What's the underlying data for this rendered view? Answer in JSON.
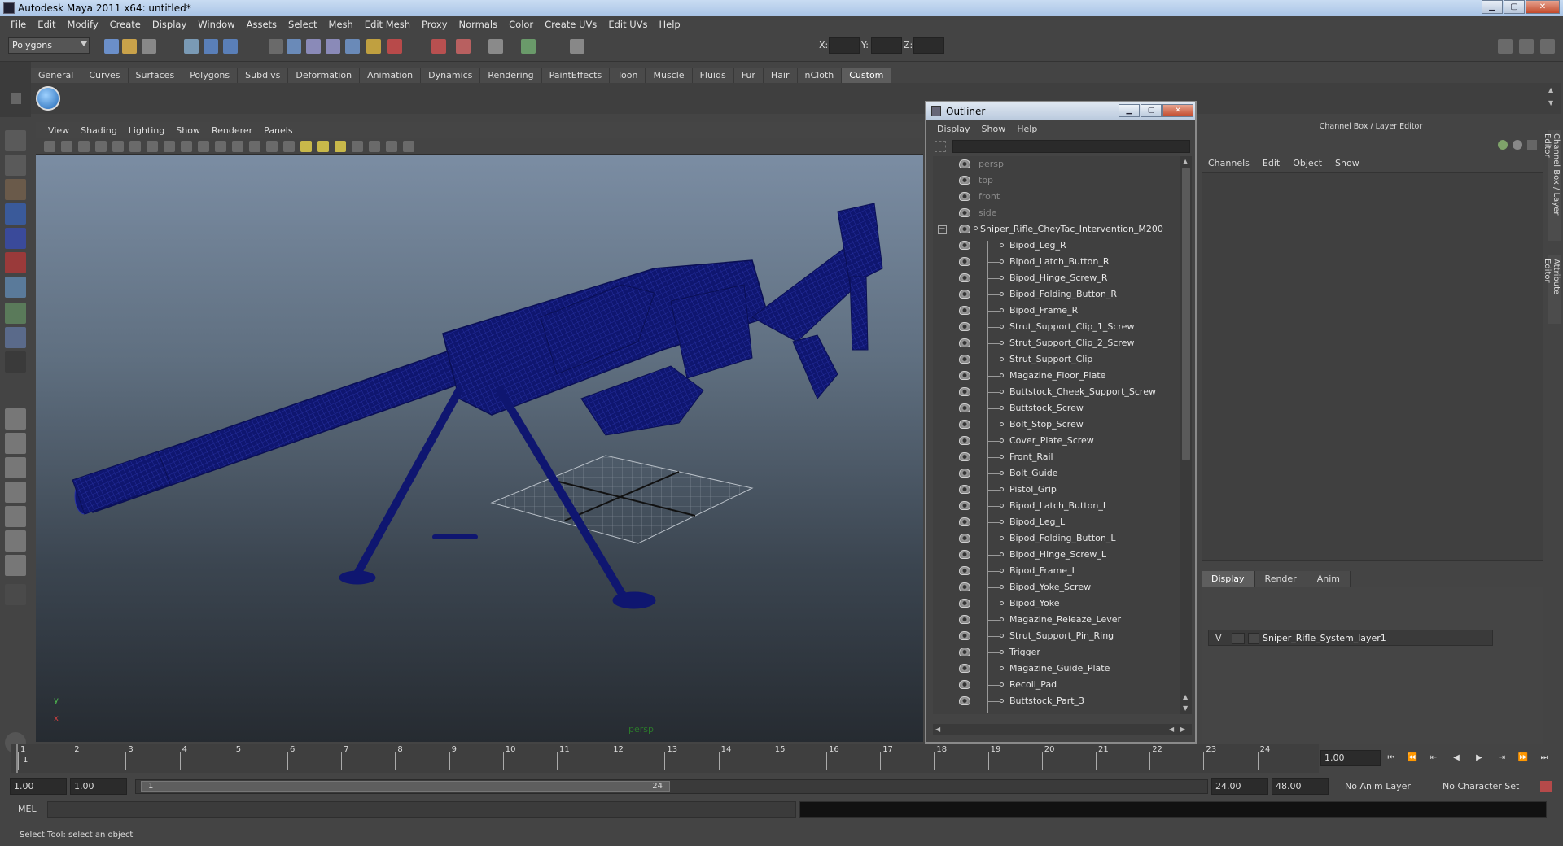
{
  "window": {
    "title": "Autodesk Maya 2011 x64: untitled*"
  },
  "menus": [
    "File",
    "Edit",
    "Modify",
    "Create",
    "Display",
    "Window",
    "Assets",
    "Select",
    "Mesh",
    "Edit Mesh",
    "Proxy",
    "Normals",
    "Color",
    "Create UVs",
    "Edit UVs",
    "Help"
  ],
  "toolbar": {
    "mode": "Polygons",
    "x_label": "X:",
    "y_label": "Y:",
    "z_label": "Z:"
  },
  "shelf_tabs": [
    "General",
    "Curves",
    "Surfaces",
    "Polygons",
    "Subdivs",
    "Deformation",
    "Animation",
    "Dynamics",
    "Rendering",
    "PaintEffects",
    "Toon",
    "Muscle",
    "Fluids",
    "Fur",
    "Hair",
    "nCloth",
    "Custom"
  ],
  "shelf_active": "Custom",
  "viewport": {
    "menus": [
      "View",
      "Shading",
      "Lighting",
      "Show",
      "Renderer",
      "Panels"
    ],
    "camera": "persp",
    "axis_x": "x",
    "axis_y": "y"
  },
  "outliner": {
    "title": "Outliner",
    "menus": [
      "Display",
      "Show",
      "Help"
    ],
    "cameras": [
      "persp",
      "top",
      "front",
      "side"
    ],
    "root": "Sniper_Rifle_CheyTac_Intervention_M200",
    "collapse_glyph": "−",
    "children": [
      "Bipod_Leg_R",
      "Bipod_Latch_Button_R",
      "Bipod_Hinge_Screw_R",
      "Bipod_Folding_Button_R",
      "Bipod_Frame_R",
      "Strut_Support_Clip_1_Screw",
      "Strut_Support_Clip_2_Screw",
      "Strut_Support_Clip",
      "Magazine_Floor_Plate",
      "Buttstock_Cheek_Support_Screw",
      "Buttstock_Screw",
      "Bolt_Stop_Screw",
      "Cover_Plate_Screw",
      "Front_Rail",
      "Bolt_Guide",
      "Pistol_Grip",
      "Bipod_Latch_Button_L",
      "Bipod_Leg_L",
      "Bipod_Folding_Button_L",
      "Bipod_Hinge_Screw_L",
      "Bipod_Frame_L",
      "Bipod_Yoke_Screw",
      "Bipod_Yoke",
      "Magazine_Releaze_Lever",
      "Strut_Support_Pin_Ring",
      "Trigger",
      "Magazine_Guide_Plate",
      "Recoil_Pad",
      "Buttstock_Part_3"
    ]
  },
  "channel_box": {
    "header": "Channel Box / Layer Editor",
    "menus": [
      "Channels",
      "Edit",
      "Object",
      "Show"
    ]
  },
  "layer_editor": {
    "tabs": [
      "Display",
      "Render",
      "Anim"
    ],
    "active_tab": "Display",
    "layer": {
      "visible": "V",
      "name": "Sniper_Rifle_System_layer1"
    }
  },
  "side_tabs": [
    "Channel Box / Layer Editor",
    "Attribute Editor"
  ],
  "timeline": {
    "ticks": [
      "1",
      "2",
      "3",
      "4",
      "5",
      "6",
      "7",
      "8",
      "9",
      "10",
      "11",
      "12",
      "13",
      "14",
      "15",
      "16",
      "17",
      "18",
      "19",
      "20",
      "21",
      "22",
      "23",
      "24"
    ],
    "current": "1",
    "current_frame": "1.00"
  },
  "range": {
    "start": "1.00",
    "playback_start": "1.00",
    "slider_start": "1",
    "slider_end": "24",
    "playback_end": "24.00",
    "end": "48.00",
    "anim_layer": "No Anim Layer",
    "character_set": "No Character Set"
  },
  "command": {
    "label": "MEL"
  },
  "help_line": "Select Tool: select an object",
  "colors": {
    "wireframe": "#141b7a",
    "accent": "#5d5d5d"
  }
}
